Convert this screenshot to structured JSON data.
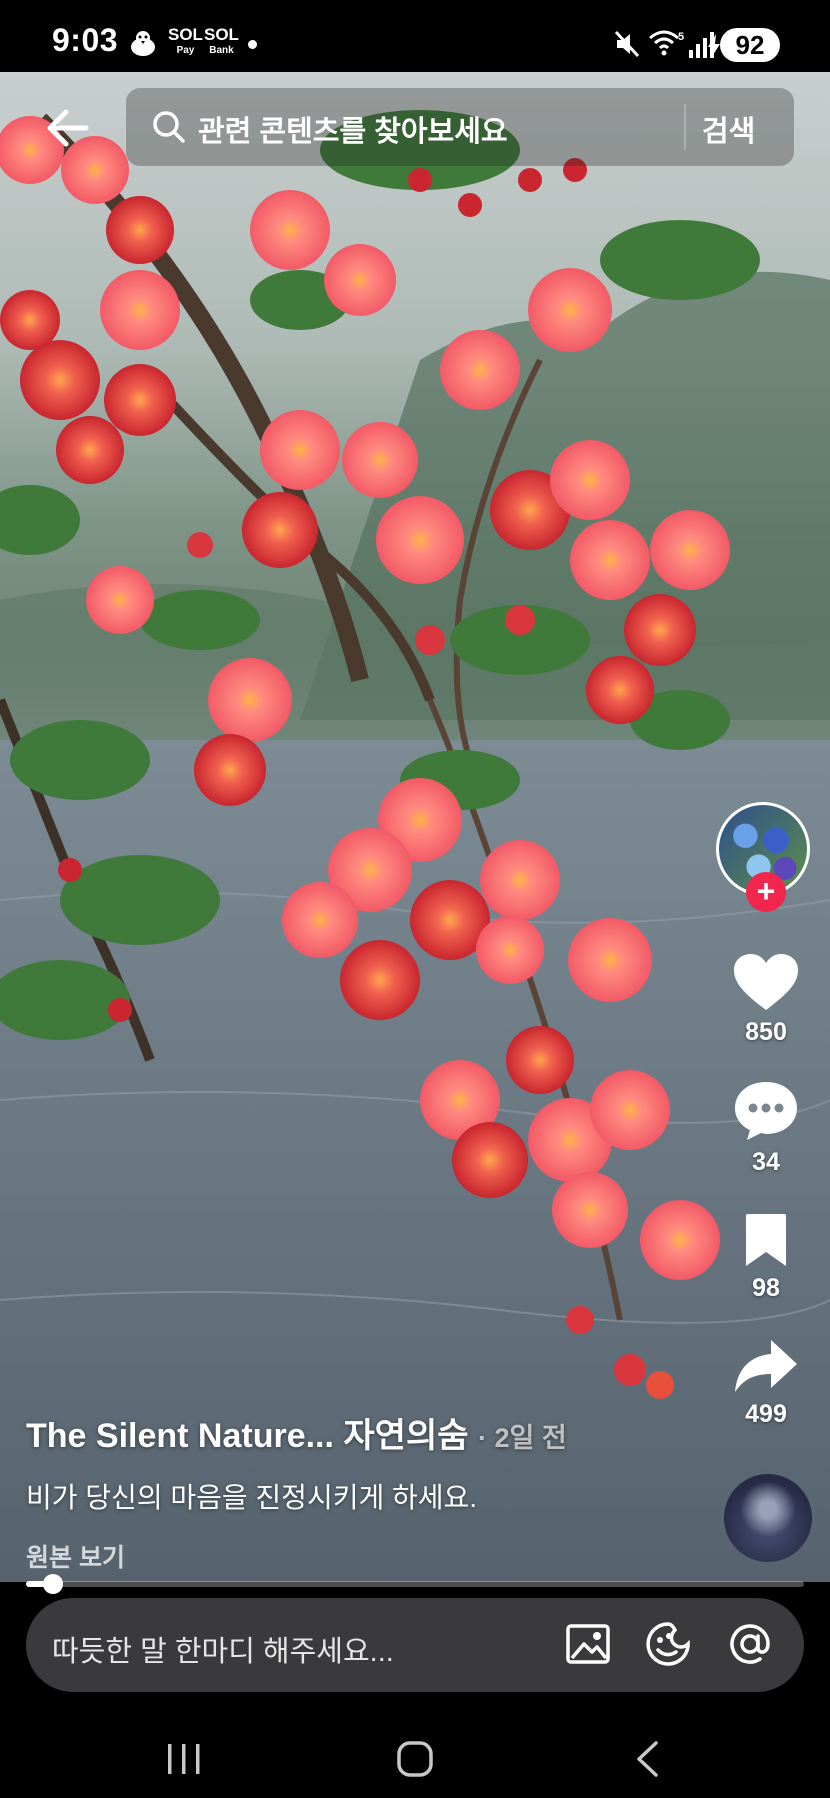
{
  "status_bar": {
    "time": "9:03",
    "apps": [
      {
        "icon": "chicken-icon"
      },
      {
        "label_top": "SOL",
        "label_bottom": "Pay"
      },
      {
        "label_top": "SOL",
        "label_bottom": "Bank"
      }
    ],
    "battery": "92",
    "icons": [
      "mute-icon",
      "wifi-5g-icon",
      "signal-icon",
      "charging-icon"
    ]
  },
  "search": {
    "placeholder": "관련 콘텐츠를 찾아보세요",
    "button": "검색"
  },
  "actions": {
    "likes": "850",
    "comments": "34",
    "saves": "98",
    "shares": "499"
  },
  "post": {
    "author": "The Silent Nature... 자연의숨",
    "time_ago": "· 2일 전",
    "caption": "비가 당신의 마음을 진정시키게 하세요.",
    "view_original": "원본 보기",
    "progress": 0.035
  },
  "comment_bar": {
    "placeholder": "따듯한 말 한마디 해주세요..."
  },
  "colors": {
    "follow": "#f0264d",
    "comment_bar": "#3a3a3c"
  }
}
